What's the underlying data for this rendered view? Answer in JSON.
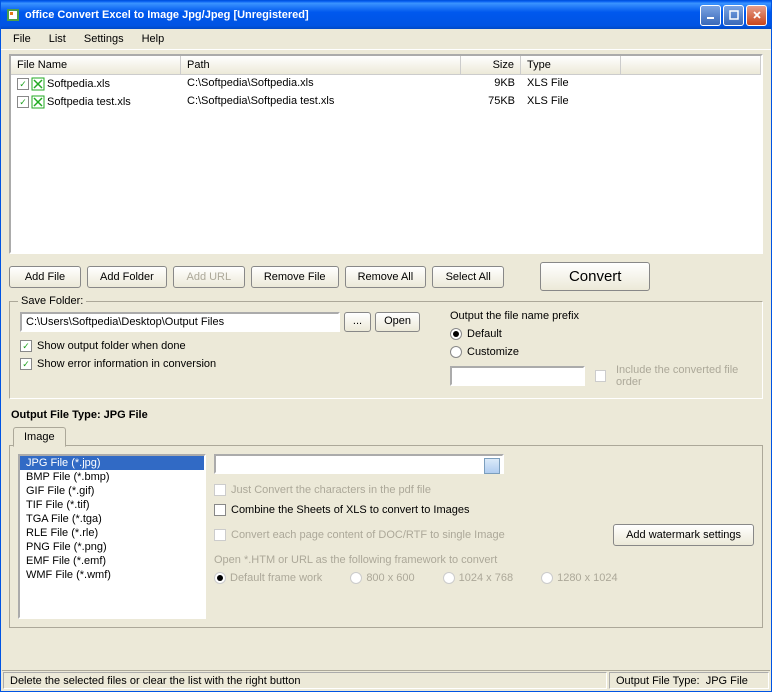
{
  "title": "office Convert Excel to Image Jpg/Jpeg [Unregistered]",
  "menu": {
    "file": "File",
    "list": "List",
    "settings": "Settings",
    "help": "Help"
  },
  "columns": {
    "name": "File Name",
    "path": "Path",
    "size": "Size",
    "type": "Type"
  },
  "files": [
    {
      "name": "Softpedia.xls",
      "path": "C:\\Softpedia\\Softpedia.xls",
      "size": "9KB",
      "type": "XLS File"
    },
    {
      "name": "Softpedia test.xls",
      "path": "C:\\Softpedia\\Softpedia test.xls",
      "size": "75KB",
      "type": "XLS File"
    }
  ],
  "buttons": {
    "addFile": "Add File",
    "addFolder": "Add Folder",
    "addUrl": "Add URL",
    "removeFile": "Remove File",
    "removeAll": "Remove All",
    "selectAll": "Select All",
    "convert": "Convert"
  },
  "save": {
    "title": "Save Folder:",
    "path": "C:\\Users\\Softpedia\\Desktop\\Output Files",
    "browse": "...",
    "open": "Open",
    "showFolder": "Show output folder when done",
    "showError": "Show error information in conversion"
  },
  "prefix": {
    "title": "Output the file name prefix",
    "default": "Default",
    "customize": "Customize",
    "include": "Include the converted file order"
  },
  "outputTypeLabel": "Output File Type:  JPG File",
  "tab": "Image",
  "formats": [
    "JPG File  (*.jpg)",
    "BMP File  (*.bmp)",
    "GIF File  (*.gif)",
    "TIF File  (*.tif)",
    "TGA File  (*.tga)",
    "RLE File  (*.rle)",
    "PNG File  (*.png)",
    "EMF File  (*.emf)",
    "WMF File  (*.wmf)"
  ],
  "opts": {
    "justChars": "Just Convert the characters in the pdf file",
    "combine": "Combine the Sheets of XLS to convert to Images",
    "eachPage": "Convert each page content of DOC/RTF to single Image",
    "watermark": "Add watermark settings",
    "framework": "Open *.HTM or URL as the following framework to convert",
    "f1": "Default frame work",
    "f2": "800 x 600",
    "f3": "1024 x 768",
    "f4": "1280 x 1024"
  },
  "status": {
    "left": "Delete the selected files or clear the list with the right button",
    "rightLabel": "Output File Type:",
    "rightValue": "JPG File"
  }
}
